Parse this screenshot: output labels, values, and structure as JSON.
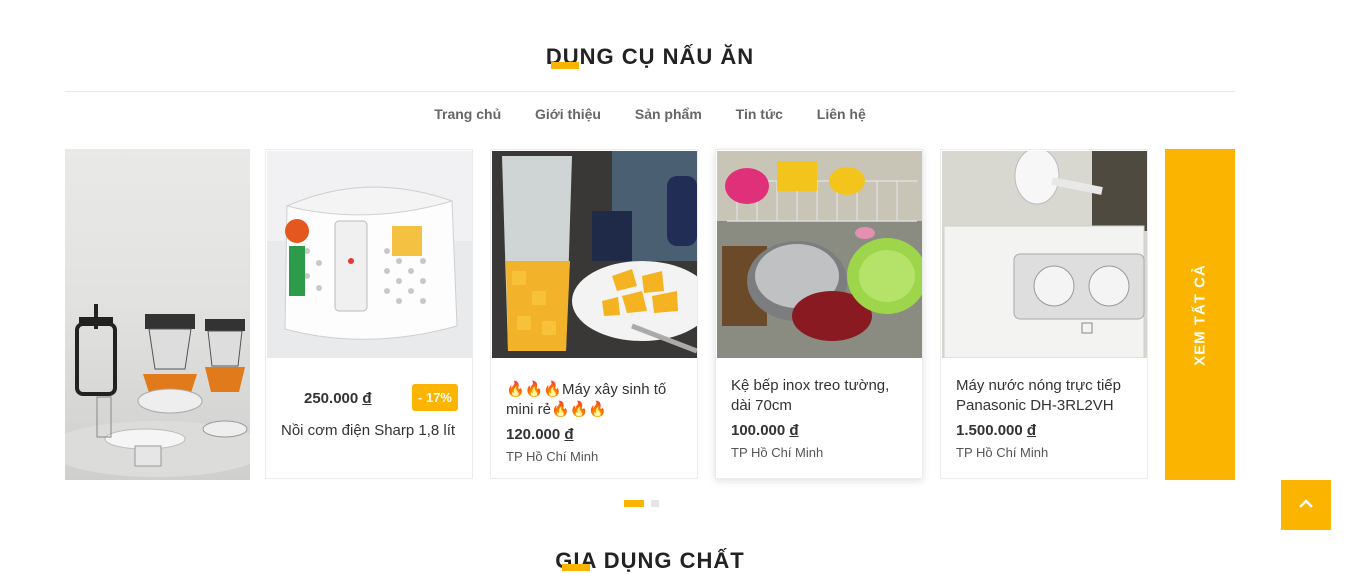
{
  "section": {
    "title": "DỤNG CỤ NẤU ĂN",
    "next_title": "GIA DỤNG CHẤT"
  },
  "tabs": [
    "Trang chủ",
    "Giới thiệu",
    "Sản phẩm",
    "Tin tức",
    "Liên hệ"
  ],
  "products": [
    {
      "name": "Nồi cơm điện Sharp 1,8 lít",
      "price": "250.000",
      "currency": "đ",
      "discount": "- 17%",
      "location": ""
    },
    {
      "name": "🔥🔥🔥Máy xây sinh tố mini rẻ🔥🔥🔥",
      "price": "120.000",
      "currency": "đ",
      "location": "TP Hồ Chí Minh"
    },
    {
      "name": "Kệ bếp inox treo tường, dài 70cm",
      "price": "100.000",
      "currency": "đ",
      "location": "TP Hồ Chí Minh"
    },
    {
      "name": "Máy nước nóng trực tiếp Panasonic DH-3RL2VH",
      "price": "1.500.000",
      "currency": "đ",
      "location": "TP Hồ Chí Minh"
    }
  ],
  "see_all": "XEM TẤT CẢ",
  "colors": {
    "accent": "#fbb500",
    "text": "#333333"
  },
  "icons": {
    "back_to_top": "chevron-up-icon"
  }
}
